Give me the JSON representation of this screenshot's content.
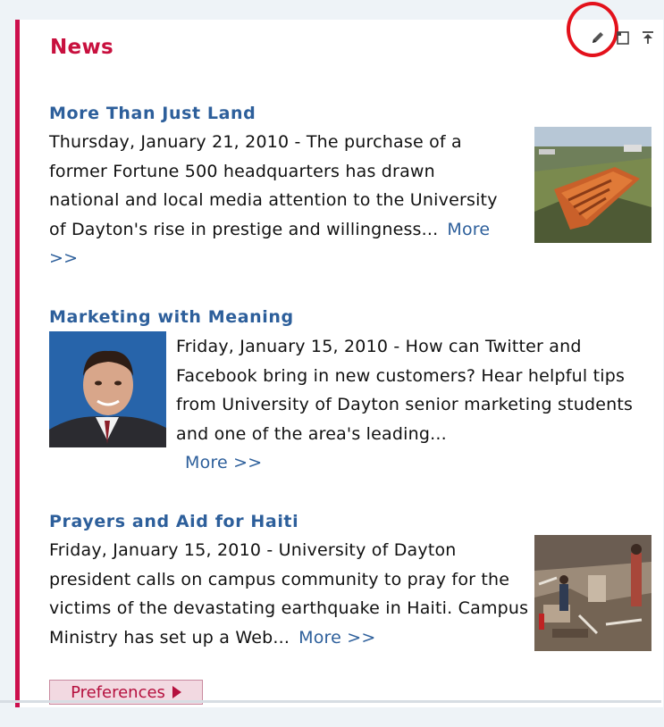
{
  "panel": {
    "title": "News",
    "controls": [
      "edit-icon",
      "restore-icon",
      "minimize-icon"
    ],
    "accent_color": "#cc0f4d",
    "link_color": "#2d5f9b"
  },
  "articles": [
    {
      "headline": "More Than Just Land",
      "body": "Thursday, January 21, 2010 - The purchase of a former Fortune 500 headquarters has drawn national and local media attention to the University of Dayton's rise in prestige and willingness...",
      "more": "More >>",
      "image": "aerial-building-photo"
    },
    {
      "headline": "Marketing with Meaning",
      "body": "Friday, January 15, 2010 - How can Twitter and Facebook bring in new customers? Hear helpful tips from University of Dayton senior marketing students and one of the area's leading...",
      "more": "More >>",
      "image": "portrait-photo"
    },
    {
      "headline": "Prayers and Aid for Haiti",
      "body": "Friday, January 15, 2010 - University of Dayton president calls on campus community to pray for the victims of the devastating earthquake in Haiti. Campus Ministry has set up a Web...",
      "more": "More >>",
      "image": "earthquake-rubble-photo"
    }
  ],
  "preferences": {
    "label": "Preferences"
  }
}
